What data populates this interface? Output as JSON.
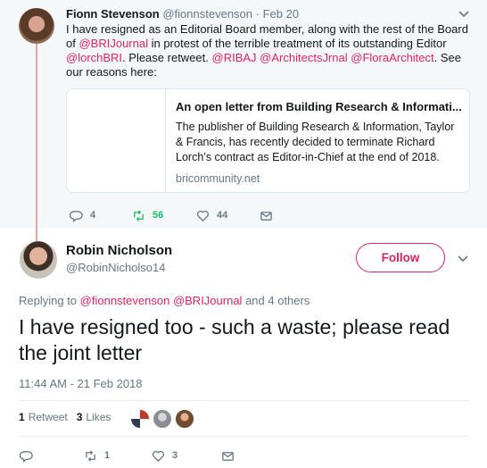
{
  "parent_tweet": {
    "author_name": "Fionn Stevenson",
    "author_handle": "@fionnstevenson",
    "date_sep": " · ",
    "date": "Feb 20",
    "text_1": "I have resigned as an Editorial Board member, along with the rest of the Board of ",
    "mention_journal": "@BRIJournal",
    "text_2": " in protest of the terrible treatment of its outstanding Editor ",
    "mention_editor": "@lorchBRI",
    "text_3": ".  Please retweet.  ",
    "mention_ribaj": "@RIBAJ",
    "mention_archjrnal": "@ArchitectsJrnal",
    "mention_flora": "@FloraArchitect",
    "text_4": ". See our reasons here:",
    "card": {
      "title": "An open letter from Building Research & Informati...",
      "description": "The publisher of Building Research & Information, Taylor & Francis, has recently decided to terminate Richard Lorch’s contract as Editor-in-Chief at the end of 2018.",
      "domain": "bricommunity.net"
    },
    "reply_count": "4",
    "retweet_count": "56",
    "like_count": "44"
  },
  "main_tweet": {
    "author_name": "Robin Nicholson",
    "author_handle": "@RobinNicholso14",
    "follow_label": "Follow",
    "replying_prefix": "Replying to ",
    "replying_user_1": "@fionnstevenson",
    "replying_user_2": "@BRIJournal",
    "replying_suffix": " and 4 others",
    "text": "I have resigned too - such a waste; please read the joint letter",
    "timestamp": "11:44 AM - 21 Feb 2018",
    "retweets_count": "1",
    "retweets_label": "Retweet",
    "likes_count": "3",
    "likes_label": "Likes",
    "reply_count": "",
    "retweet_count": "1",
    "like_count": "3"
  },
  "colors": {
    "accent": "#e0245e",
    "retweet_green": "#17bf63",
    "muted": "#657786"
  },
  "icons": [
    "chevron-down-icon",
    "reply-icon",
    "retweet-icon",
    "like-icon",
    "message-icon"
  ]
}
